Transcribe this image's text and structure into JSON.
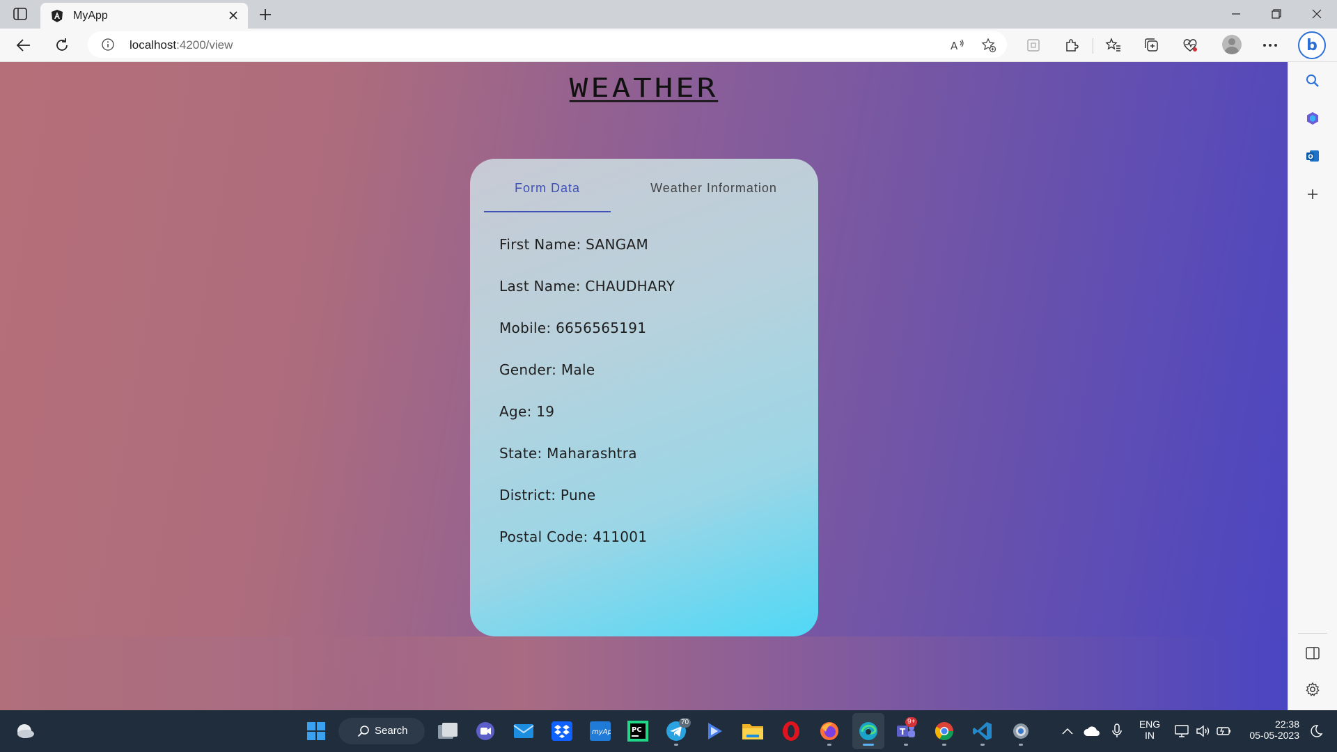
{
  "browser": {
    "tab_title": "MyApp",
    "url_host": "localhost",
    "url_path": ":4200/view",
    "bing_label": "b"
  },
  "page": {
    "brand": "WEATHER",
    "tabs": [
      {
        "label": "Form Data",
        "active": true
      },
      {
        "label": "Weather Information",
        "active": false
      }
    ],
    "fields": [
      "First Name: SANGAM",
      "Last Name: CHAUDHARY",
      "Mobile: 6656565191",
      "Gender: Male",
      "Age: 19",
      "State: Maharashtra",
      "District: Pune",
      "Postal Code: 411001"
    ]
  },
  "taskbar": {
    "search_label": "Search",
    "telegram_badge": "70",
    "teams_badge": "9+",
    "lang_top": "ENG",
    "lang_bottom": "IN",
    "time": "22:38",
    "date": "05-05-2023"
  },
  "colors": {
    "accent": "#3f51b5",
    "bing": "#2b6fd8",
    "taskbar": "#1f2d3d"
  }
}
